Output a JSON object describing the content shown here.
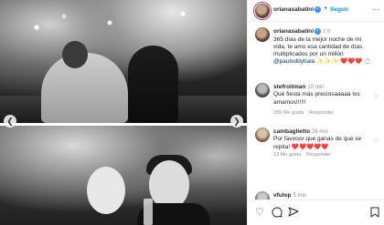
{
  "post": {
    "username": "orianasabatini",
    "follow_label": "Seguir",
    "more_label": "...",
    "caption_user": "orianasabatini",
    "caption_time": "1 h",
    "caption_text": "365 días de la mejor noche de mi vida, te amo esa cantidad de días multiplicados por un millón",
    "caption_mention": "@pauloddybala",
    "caption_emojis": "✨✨✨ ❤️❤️❤️ 💍"
  },
  "comments": [
    {
      "user": "stefroitman",
      "time": "10 min",
      "text": "Qué fiesta más preciosaaaaa los amamos!!!!!!",
      "likes": "155 Me gusta",
      "reply": "Responder"
    },
    {
      "user": "cambaglietto",
      "time": "26 min",
      "text": "Por favooor que ganas de que se repita! ❤️❤️❤️❤️❤️",
      "likes": "13 Me gusta",
      "reply": "Responder"
    },
    {
      "user": "vfulop",
      "time": "5 min",
      "text": "",
      "likes": "",
      "reply": ""
    }
  ],
  "icons": {
    "like": "heart-icon",
    "comment": "comment-icon",
    "share": "share-icon",
    "save": "bookmark-icon",
    "prev": "chevron-left-icon",
    "next": "chevron-right-icon"
  },
  "colors": {
    "link": "#0095f6",
    "text": "#262626",
    "muted": "#8e8e8e",
    "verified": "#3897f0"
  }
}
